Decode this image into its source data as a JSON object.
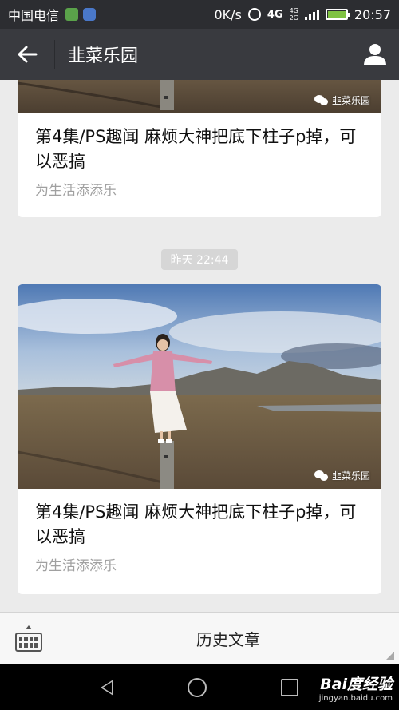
{
  "status_bar": {
    "carrier": "中国电信",
    "speed": "0K/s",
    "network_top": "4G",
    "network_small": "4G",
    "network_small2": "2G",
    "time": "20:57"
  },
  "header": {
    "title": "韭菜乐园",
    "back_icon": "arrow-left-icon",
    "profile_icon": "user-icon"
  },
  "articles": [
    {
      "title": "第4集/PS趣闻  麻烦大神把底下柱子p掉，可以恶搞",
      "subtitle": "为生活添添乐",
      "watermark": "韭菜乐园"
    },
    {
      "title": "第4集/PS趣闻  麻烦大神把底下柱子p掉，可以恶搞",
      "subtitle": "为生活添添乐",
      "watermark": "韭菜乐园"
    }
  ],
  "timestamp": "昨天 22:44",
  "bottom_bar": {
    "keyboard_icon": "keyboard-icon",
    "history_label": "历史文章"
  },
  "brand": {
    "name": "Bai度经验",
    "url": "jingyan.baidu.com"
  }
}
